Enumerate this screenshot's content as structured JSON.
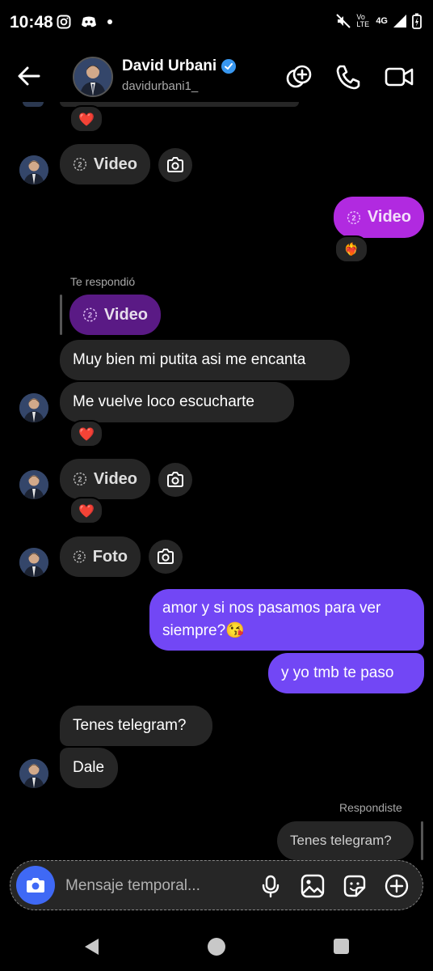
{
  "status_bar": {
    "time": "10:48",
    "network": "4G",
    "volte": "Vo LTE"
  },
  "header": {
    "name": "David Urbani",
    "username": "davidurbani1_",
    "verified_color": "#3897f0"
  },
  "labels": {
    "video": "Video",
    "foto": "Foto",
    "replied_to_you": "Te respondió",
    "you_replied": "Respondiste",
    "view_once_count": "2"
  },
  "messages": {
    "m1": "Muy bien mi putita asi me encanta",
    "m2": "Me vuelve loco escucharte",
    "m3_line1": "amor y si nos pasamos para ver",
    "m3_line2": "siempre?😘",
    "m4": "y yo tmb te paso",
    "m5": "Tenes telegram?",
    "m6": "Dale",
    "m7": "Tenes telegram?"
  },
  "reactions": {
    "heart": "❤️",
    "heart_fire": "❤️‍🔥"
  },
  "composer": {
    "placeholder": "Mensaje temporal..."
  },
  "colors": {
    "outgoing": "#7247f5",
    "outgoing_magenta": "#b12ae0",
    "incoming": "#262626",
    "composer_camera": "#3f69f5"
  }
}
